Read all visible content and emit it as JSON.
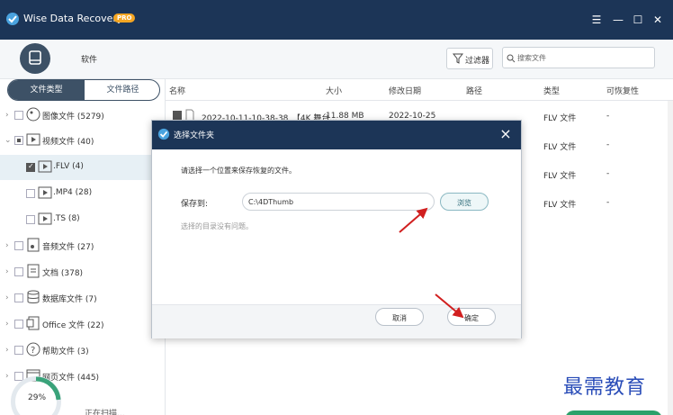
{
  "app": {
    "title": "Wise Data Recovery",
    "badge": "PRO"
  },
  "window_controls": {
    "menu": "☰",
    "minimize": "—",
    "maximize": "☐",
    "close": "✕"
  },
  "toolbar": {
    "drive_label": "软件",
    "filter_label": "过滤器",
    "search_placeholder": "搜索文件"
  },
  "sidebar": {
    "tabs": {
      "file_type": "文件类型",
      "file_path": "文件路径"
    },
    "items": [
      {
        "label": "图像文件 (5279)",
        "icon": "image-icon"
      },
      {
        "label": "视频文件 (40)",
        "icon": "video-icon"
      },
      {
        "label": ".FLV (4)",
        "icon": "video-file-icon"
      },
      {
        "label": ".MP4 (28)",
        "icon": "video-file-icon"
      },
      {
        "label": ".TS (8)",
        "icon": "video-file-icon"
      },
      {
        "label": "音频文件 (27)",
        "icon": "audio-icon"
      },
      {
        "label": "文档 (378)",
        "icon": "document-icon"
      },
      {
        "label": "数据库文件 (7)",
        "icon": "database-icon"
      },
      {
        "label": "Office 文件 (22)",
        "icon": "office-icon"
      },
      {
        "label": "帮助文件 (3)",
        "icon": "help-icon"
      },
      {
        "label": "网页文件 (445)",
        "icon": "web-icon"
      }
    ],
    "progress": "29%",
    "status": "正在扫描..."
  },
  "table": {
    "headers": [
      "名称",
      "大小",
      "修改日期",
      "路径",
      "类型",
      "可恢复性"
    ],
    "rows": [
      {
        "name": "2022-10-11-10-38-38_【4K 舞台...",
        "size": "11.88 MB",
        "date": "2022-10-25",
        "type": "FLV 文件",
        "recover": "-"
      },
      {
        "type": "FLV 文件",
        "recover": "-"
      },
      {
        "type": "FLV 文件",
        "recover": "-"
      },
      {
        "type": "FLV 文件",
        "recover": "-"
      }
    ]
  },
  "dialog": {
    "title": "选择文件夹",
    "instruction": "请选择一个位置来保存恢复的文件。",
    "save_to_label": "保存到:",
    "path_value": "C:\\4DThumb",
    "browse": "浏览",
    "note": "选择的目录没有问题。",
    "cancel": "取消",
    "confirm": "确定"
  },
  "watermark": "最需教育",
  "colors": {
    "titlebar": "#1c3557",
    "accent": "#3d5166",
    "pro_badge": "#f5a623",
    "arrow": "#d11f1f",
    "watermark": "#2a4db8"
  }
}
